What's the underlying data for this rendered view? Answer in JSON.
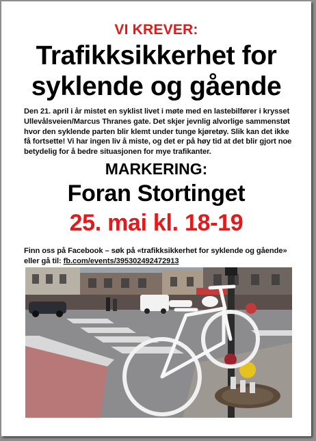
{
  "poster": {
    "kicker": "VI KREVER:",
    "headline_line1": "Trafikksikkerhet  for",
    "headline_line2": "syklende og gående",
    "intro": "Den 21. april i år mistet en syklist livet i møte med en lastebilfører i krysset Ullevålsveien/Marcus Thranes gate. Det skjer jevnlig alvorlige sammenstøt hvor den syklende parten blir klemt under tunge kjøretøy. Slik kan det ikke få fortsette! Vi har ingen liv å miste, og det er på høy tid at det blir gjort noe betydelig for å bedre situasjonen for mye trafikanter.",
    "marking_label": "MARKERING:",
    "place": "Foran Stortinget",
    "date_time": "25. mai kl. 18-19",
    "facebook_text": "Finn oss på Facebook – søk på «trafikksikkerhet for syklende og gående» eller gå til:",
    "facebook_link": "fb.com/events/395302492472913"
  },
  "colors": {
    "accent_red": "#e3191b",
    "text": "#000000",
    "page": "#ffffff",
    "backdrop": "#8f8f8f"
  },
  "photo": {
    "icon": "ghost-bike-memorial-photo"
  }
}
